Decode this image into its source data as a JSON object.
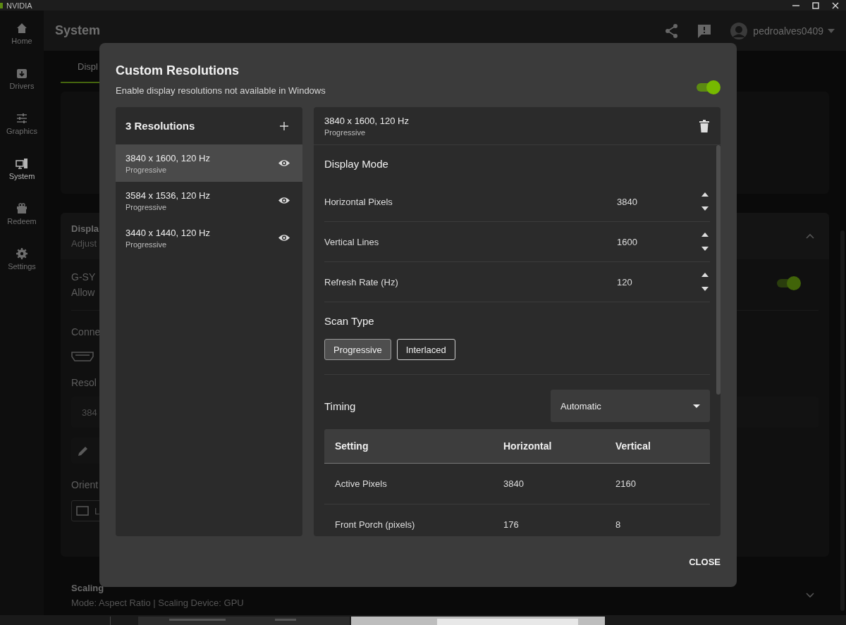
{
  "window": {
    "title": "NVIDIA"
  },
  "sidebar": {
    "items": [
      {
        "label": "Home",
        "selected": false
      },
      {
        "label": "Drivers",
        "selected": false
      },
      {
        "label": "Graphics",
        "selected": false
      },
      {
        "label": "System",
        "selected": true
      },
      {
        "label": "Redeem",
        "selected": false
      },
      {
        "label": "Settings",
        "selected": false
      }
    ]
  },
  "header": {
    "title": "System",
    "username": "pedroalves0409"
  },
  "page": {
    "tab": {
      "label": "Displ",
      "selected": true
    },
    "display_card": {
      "title": "Displa",
      "subtitle": "Adjust",
      "expanded": true
    },
    "gsync": {
      "title": "G-SY",
      "subtitle": "Allow",
      "on": true
    },
    "connector_label": "Conne",
    "resolution_label": "Resol",
    "resolution_value": "384",
    "orientation_label": "Orient",
    "orientation_button": "L",
    "scaling": {
      "title": "Scaling",
      "subtitle": "Mode: Aspect Ratio | Scaling Device: GPU",
      "expanded": false
    }
  },
  "dialog": {
    "title": "Custom Resolutions",
    "subtitle": "Enable display resolutions not available in Windows",
    "enabled": true,
    "list_title": "3 Resolutions",
    "resolutions": [
      {
        "name": "3840 x 1600, 120 Hz",
        "scan": "Progressive",
        "selected": true
      },
      {
        "name": "3584 x 1536, 120 Hz",
        "scan": "Progressive",
        "selected": false
      },
      {
        "name": "3440 x 1440, 120 Hz",
        "scan": "Progressive",
        "selected": false
      }
    ],
    "detail": {
      "title": "3840 x 1600, 120 Hz",
      "subtitle": "Progressive",
      "mode_heading": "Display Mode",
      "fields": [
        {
          "label": "Horizontal Pixels",
          "value": "3840"
        },
        {
          "label": "Vertical Lines",
          "value": "1600"
        },
        {
          "label": "Refresh Rate (Hz)",
          "value": "120"
        }
      ],
      "scan_heading": "Scan Type",
      "scan_options": [
        {
          "label": "Progressive",
          "selected": true
        },
        {
          "label": "Interlaced",
          "selected": false
        }
      ],
      "timing_label": "Timing",
      "timing_mode": "Automatic",
      "table": {
        "columns": [
          "Setting",
          "Horizontal",
          "Vertical"
        ],
        "rows": [
          [
            "Active Pixels",
            "3840",
            "2160"
          ],
          [
            "Front Porch (pixels)",
            "176",
            "8"
          ]
        ]
      }
    },
    "close_button": "CLOSE"
  }
}
